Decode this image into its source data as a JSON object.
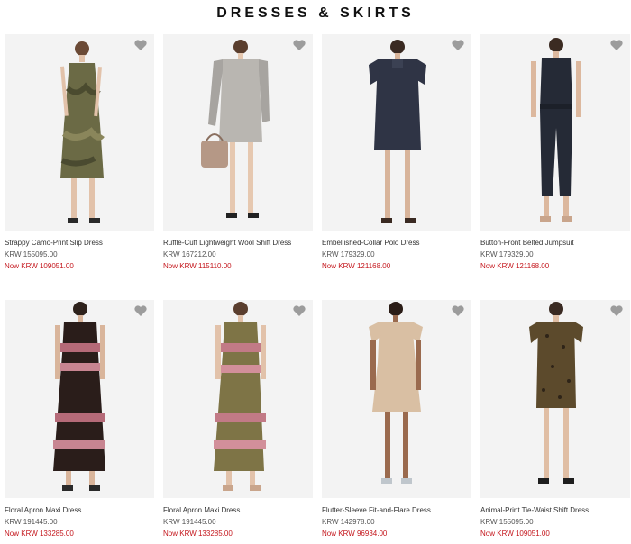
{
  "page": {
    "title": "DRESSES & SKIRTS"
  },
  "colors": {
    "sale": "#c4161c",
    "heart": "#9c9c9c",
    "background": "#f3f3f3"
  },
  "products": [
    {
      "name": "Strappy Camo-Print Slip Dress",
      "price": "KRW 155095.00",
      "sale_price": "Now KRW 109051.00",
      "icon": "heart-icon"
    },
    {
      "name": "Ruffle-Cuff Lightweight Wool Shift Dress",
      "price": "KRW 167212.00",
      "sale_price": "Now KRW 115110.00",
      "icon": "heart-icon"
    },
    {
      "name": "Embellished-Collar Polo Dress",
      "price": "KRW 179329.00",
      "sale_price": "Now KRW 121168.00",
      "icon": "heart-icon"
    },
    {
      "name": "Button-Front Belted Jumpsuit",
      "price": "KRW 179329.00",
      "sale_price": "Now KRW 121168.00",
      "icon": "heart-icon"
    },
    {
      "name": "Floral Apron Maxi Dress",
      "price": "KRW 191445.00",
      "sale_price": "Now KRW 133285.00",
      "icon": "heart-icon"
    },
    {
      "name": "Floral Apron Maxi Dress",
      "price": "KRW 191445.00",
      "sale_price": "Now KRW 133285.00",
      "icon": "heart-icon"
    },
    {
      "name": "Flutter-Sleeve Fit-and-Flare Dress",
      "price": "KRW 142978.00",
      "sale_price": "Now KRW 96934.00",
      "icon": "heart-icon"
    },
    {
      "name": "Animal-Print Tie-Waist Shift Dress",
      "price": "KRW 155095.00",
      "sale_price": "Now KRW 109051.00",
      "icon": "heart-icon"
    }
  ]
}
